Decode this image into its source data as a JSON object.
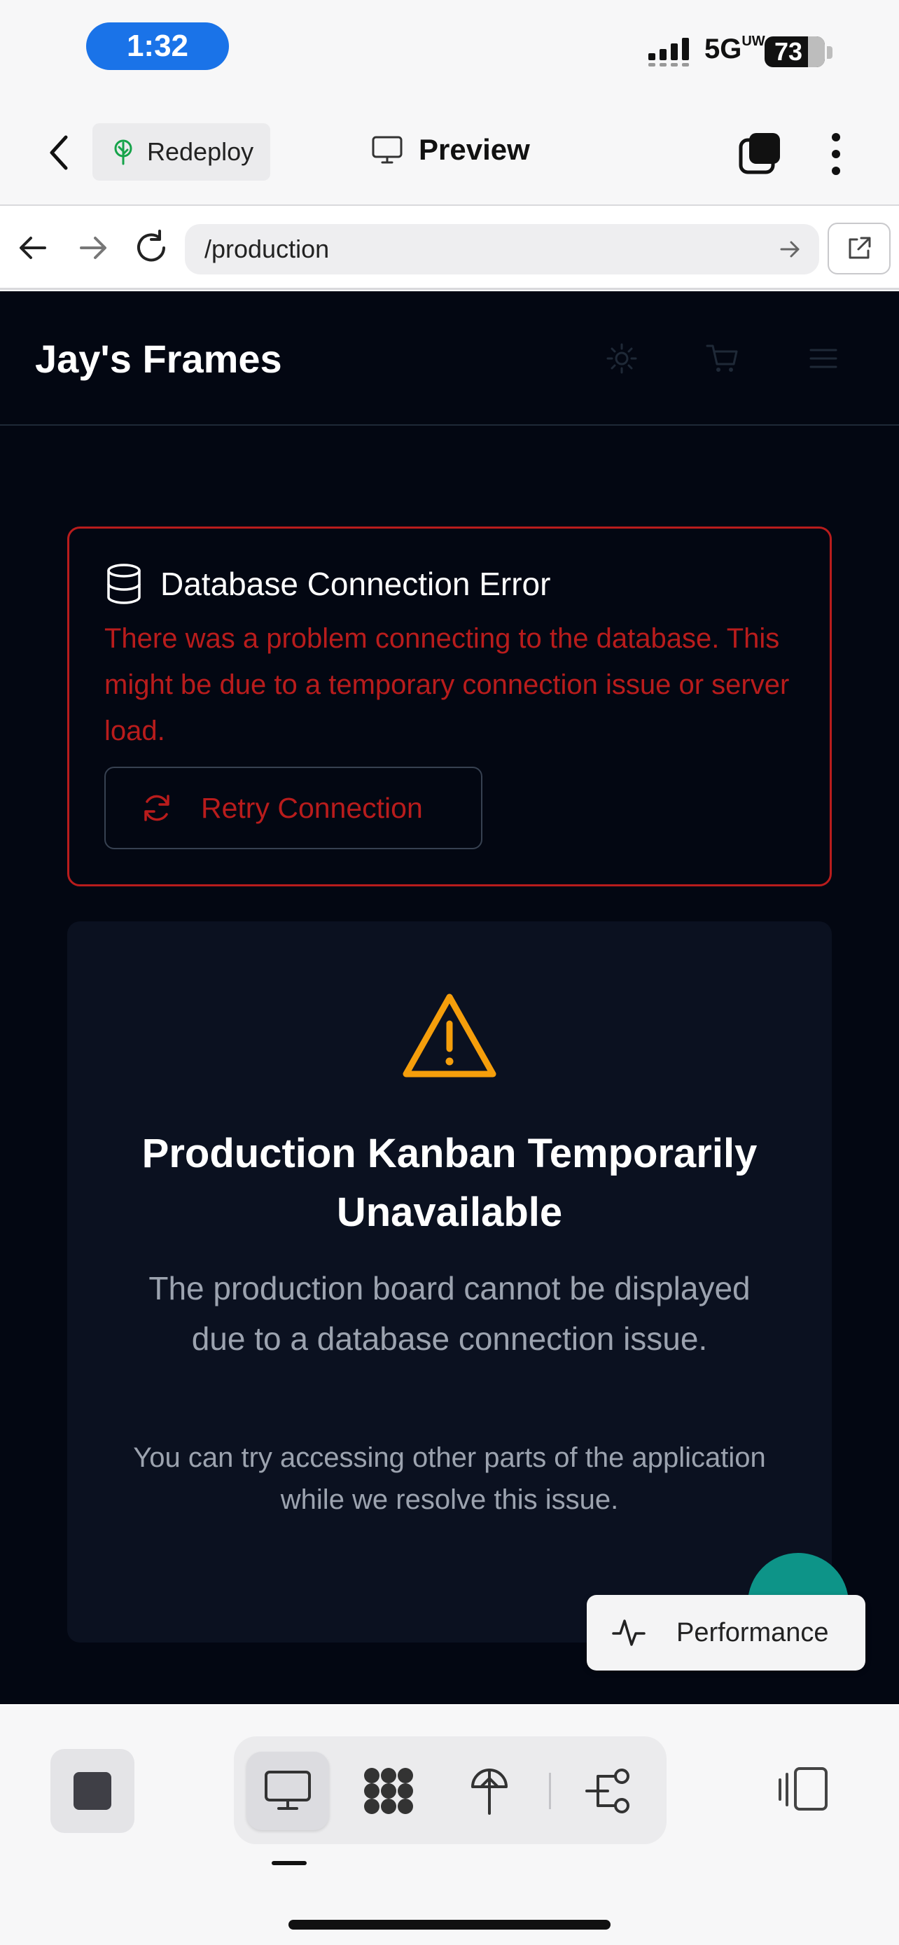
{
  "status_bar": {
    "time": "1:32",
    "network": "5G",
    "network_suffix": "UW",
    "battery": "73"
  },
  "app_header": {
    "redeploy_label": "Redeploy",
    "title": "Preview"
  },
  "browser": {
    "url": "/production"
  },
  "site": {
    "brand": "Jay's Frames",
    "error": {
      "title": "Database Connection Error",
      "message": "There was a problem connecting to the database. This might be due to a temporary connection issue or server load.",
      "retry_label": "Retry Connection"
    },
    "status": {
      "title": "Production Kanban Temporarily Unavailable",
      "description": "The production board cannot be displayed due to a database connection issue.",
      "hint": "You can try accessing other parts of the application while we resolve this issue."
    },
    "performance_label": "Performance"
  },
  "colors": {
    "site_bg": "#030712",
    "card_bg": "#0b1120",
    "error_red": "#b91c1c",
    "warning_amber": "#f59e0b",
    "fab_teal": "#0d9488",
    "time_pill": "#1a73e8"
  },
  "icons": [
    "chevron-left-icon",
    "tree-icon",
    "monitor-icon",
    "tabs-icon",
    "more-vertical-icon",
    "arrow-left-icon",
    "arrow-right-icon",
    "reload-icon",
    "external-link-icon",
    "sun-icon",
    "cart-icon",
    "menu-icon",
    "database-icon",
    "refresh-icon",
    "warning-icon",
    "activity-icon",
    "stop-icon",
    "grid-dots-icon",
    "deploy-icon",
    "flow-icon",
    "side-panel-icon"
  ]
}
